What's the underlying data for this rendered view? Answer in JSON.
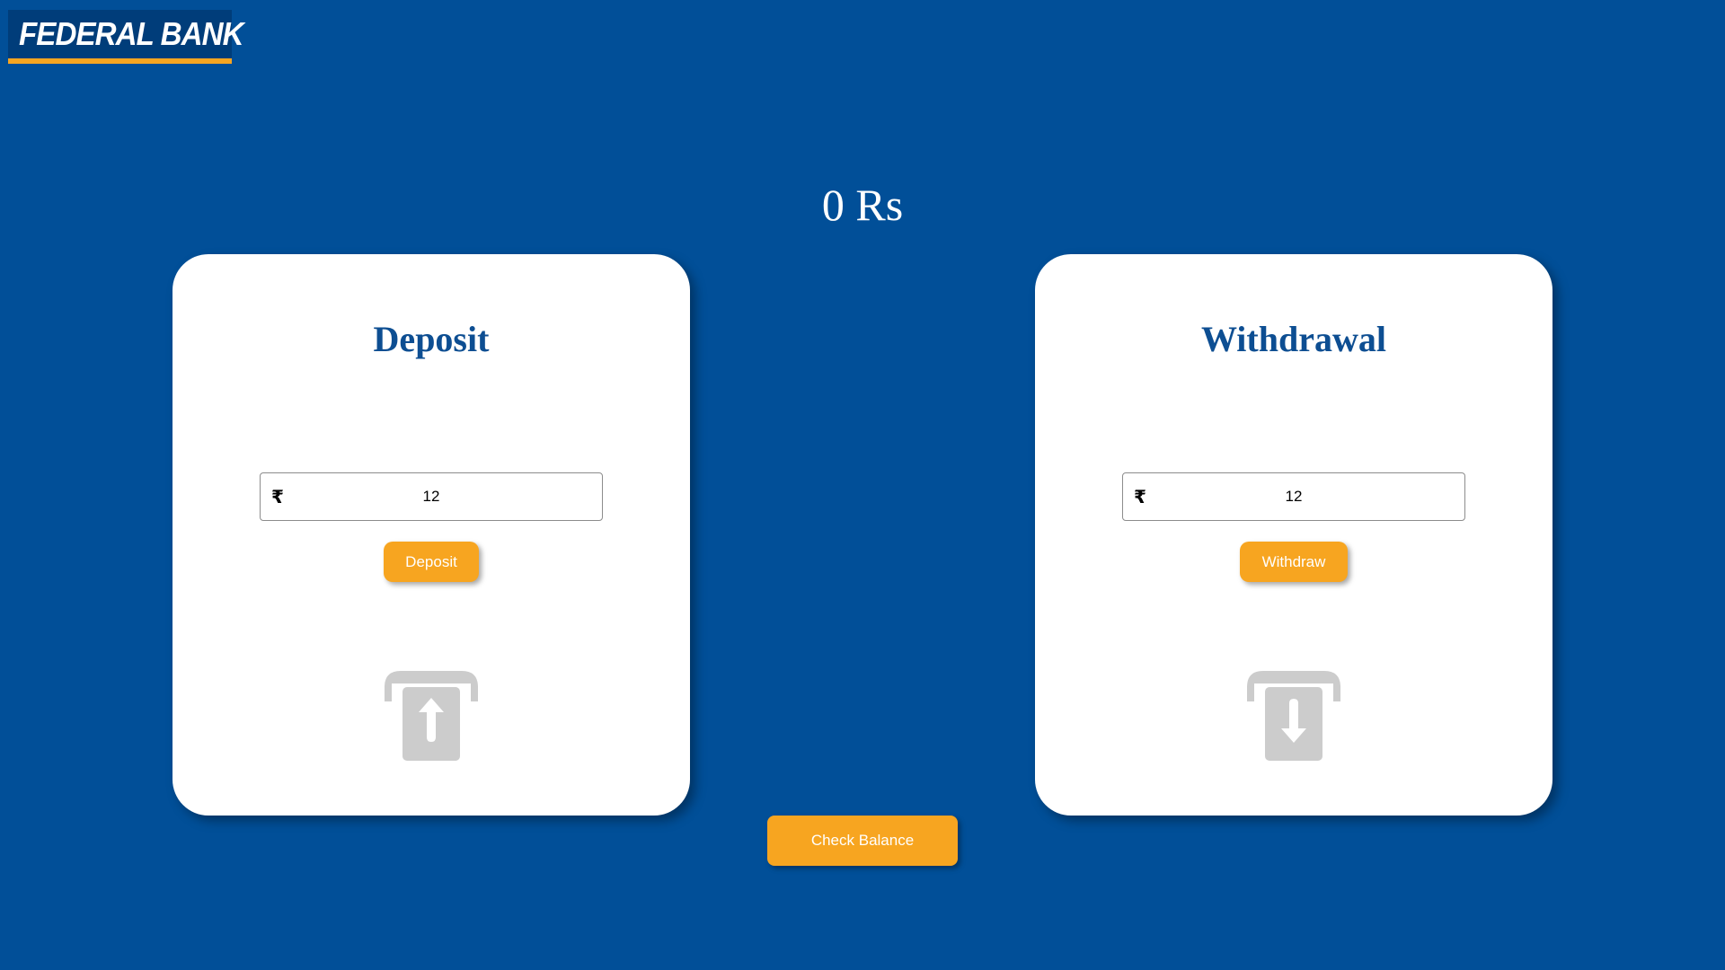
{
  "brand": {
    "logo_text": "FEDERAL BANK",
    "logo_bg": "#003d7a",
    "logo_accent": "#f7a520"
  },
  "balance": {
    "text": "0 Rs"
  },
  "deposit": {
    "title": "Deposit",
    "currency_icon": "rupee-icon",
    "currency_symbol": "₹",
    "amount_value": "12",
    "button_label": "Deposit",
    "illustration_icon": "atm-deposit-arrow-up-icon"
  },
  "withdrawal": {
    "title": "Withdrawal",
    "currency_icon": "rupee-icon",
    "currency_symbol": "₹",
    "amount_value": "12",
    "button_label": "Withdraw",
    "illustration_icon": "atm-withdraw-arrow-down-icon"
  },
  "check_balance": {
    "label": "Check Balance"
  },
  "colors": {
    "background": "#014f98",
    "accent": "#f7a520",
    "card": "#ffffff",
    "title": "#0d4e92",
    "icon_gray": "#cccccc"
  }
}
